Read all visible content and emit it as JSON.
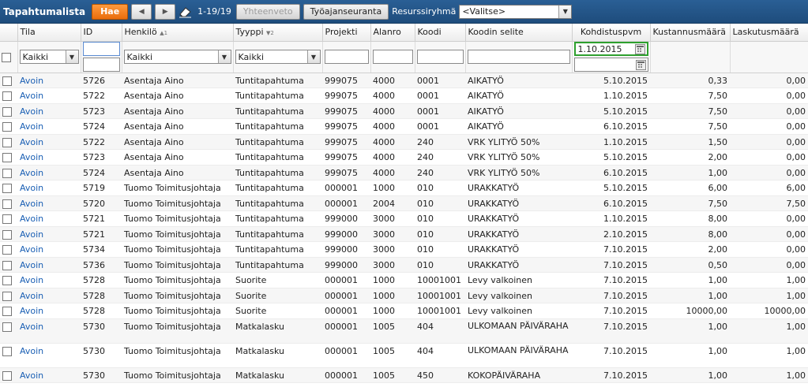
{
  "toolbar": {
    "title": "Tapahtumalista",
    "search_label": "Hae",
    "range": "1-19/19",
    "summary_label": "Yhteenveto",
    "tracking_label": "Työajanseuranta",
    "resource_group_label": "Resurssiryhmä",
    "resource_group_value": "<Valitse>"
  },
  "columns": [
    "Tila",
    "ID",
    "Henkilö",
    "Tyyppi",
    "Projekti",
    "Alanro",
    "Koodi",
    "Koodin selite",
    "Kohdistuspvm",
    "Kustannusmäärä",
    "Laskutusmäärä"
  ],
  "sort": {
    "henkilo": "▲1",
    "tyyppi": "▼2"
  },
  "filters": {
    "tila": "Kaikki",
    "henkilo": "Kaikki",
    "tyyppi": "Kaikki",
    "kohdistuspvm_from": "1.10.2015",
    "kohdistuspvm_to": ""
  },
  "rows": [
    {
      "tila": "Avoin",
      "id": "5726",
      "henkilo": "Asentaja Aino",
      "tyyppi": "Tuntitapahtuma",
      "projekti": "999075",
      "alanro": "4000",
      "koodi": "0001",
      "selite": "AIKATYÖ",
      "pvm": "5.10.2015",
      "kustannus": "0,33",
      "laskutus": "0,00"
    },
    {
      "tila": "Avoin",
      "id": "5722",
      "henkilo": "Asentaja Aino",
      "tyyppi": "Tuntitapahtuma",
      "projekti": "999075",
      "alanro": "4000",
      "koodi": "0001",
      "selite": "AIKATYÖ",
      "pvm": "1.10.2015",
      "kustannus": "7,50",
      "laskutus": "0,00"
    },
    {
      "tila": "Avoin",
      "id": "5723",
      "henkilo": "Asentaja Aino",
      "tyyppi": "Tuntitapahtuma",
      "projekti": "999075",
      "alanro": "4000",
      "koodi": "0001",
      "selite": "AIKATYÖ",
      "pvm": "5.10.2015",
      "kustannus": "7,50",
      "laskutus": "0,00"
    },
    {
      "tila": "Avoin",
      "id": "5724",
      "henkilo": "Asentaja Aino",
      "tyyppi": "Tuntitapahtuma",
      "projekti": "999075",
      "alanro": "4000",
      "koodi": "0001",
      "selite": "AIKATYÖ",
      "pvm": "6.10.2015",
      "kustannus": "7,50",
      "laskutus": "0,00"
    },
    {
      "tila": "Avoin",
      "id": "5722",
      "henkilo": "Asentaja Aino",
      "tyyppi": "Tuntitapahtuma",
      "projekti": "999075",
      "alanro": "4000",
      "koodi": "240",
      "selite": "VRK YLITYÖ 50%",
      "pvm": "1.10.2015",
      "kustannus": "1,50",
      "laskutus": "0,00"
    },
    {
      "tila": "Avoin",
      "id": "5723",
      "henkilo": "Asentaja Aino",
      "tyyppi": "Tuntitapahtuma",
      "projekti": "999075",
      "alanro": "4000",
      "koodi": "240",
      "selite": "VRK YLITYÖ 50%",
      "pvm": "5.10.2015",
      "kustannus": "2,00",
      "laskutus": "0,00"
    },
    {
      "tila": "Avoin",
      "id": "5724",
      "henkilo": "Asentaja Aino",
      "tyyppi": "Tuntitapahtuma",
      "projekti": "999075",
      "alanro": "4000",
      "koodi": "240",
      "selite": "VRK YLITYÖ 50%",
      "pvm": "6.10.2015",
      "kustannus": "1,00",
      "laskutus": "0,00"
    },
    {
      "tila": "Avoin",
      "id": "5719",
      "henkilo": "Tuomo Toimitusjohtaja",
      "tyyppi": "Tuntitapahtuma",
      "projekti": "000001",
      "alanro": "1000",
      "koodi": "010",
      "selite": "URAKKATYÖ",
      "pvm": "5.10.2015",
      "kustannus": "6,00",
      "laskutus": "6,00"
    },
    {
      "tila": "Avoin",
      "id": "5720",
      "henkilo": "Tuomo Toimitusjohtaja",
      "tyyppi": "Tuntitapahtuma",
      "projekti": "000001",
      "alanro": "2004",
      "koodi": "010",
      "selite": "URAKKATYÖ",
      "pvm": "6.10.2015",
      "kustannus": "7,50",
      "laskutus": "7,50"
    },
    {
      "tila": "Avoin",
      "id": "5721",
      "henkilo": "Tuomo Toimitusjohtaja",
      "tyyppi": "Tuntitapahtuma",
      "projekti": "999000",
      "alanro": "3000",
      "koodi": "010",
      "selite": "URAKKATYÖ",
      "pvm": "1.10.2015",
      "kustannus": "8,00",
      "laskutus": "0,00"
    },
    {
      "tila": "Avoin",
      "id": "5721",
      "henkilo": "Tuomo Toimitusjohtaja",
      "tyyppi": "Tuntitapahtuma",
      "projekti": "999000",
      "alanro": "3000",
      "koodi": "010",
      "selite": "URAKKATYÖ",
      "pvm": "2.10.2015",
      "kustannus": "8,00",
      "laskutus": "0,00"
    },
    {
      "tila": "Avoin",
      "id": "5734",
      "henkilo": "Tuomo Toimitusjohtaja",
      "tyyppi": "Tuntitapahtuma",
      "projekti": "999000",
      "alanro": "3000",
      "koodi": "010",
      "selite": "URAKKATYÖ",
      "pvm": "7.10.2015",
      "kustannus": "2,00",
      "laskutus": "0,00"
    },
    {
      "tila": "Avoin",
      "id": "5736",
      "henkilo": "Tuomo Toimitusjohtaja",
      "tyyppi": "Tuntitapahtuma",
      "projekti": "999000",
      "alanro": "3000",
      "koodi": "010",
      "selite": "URAKKATYÖ",
      "pvm": "7.10.2015",
      "kustannus": "0,50",
      "laskutus": "0,00"
    },
    {
      "tila": "Avoin",
      "id": "5728",
      "henkilo": "Tuomo Toimitusjohtaja",
      "tyyppi": "Suorite",
      "projekti": "000001",
      "alanro": "1000",
      "koodi": "10001001",
      "selite": "Levy valkoinen",
      "pvm": "7.10.2015",
      "kustannus": "1,00",
      "laskutus": "1,00"
    },
    {
      "tila": "Avoin",
      "id": "5728",
      "henkilo": "Tuomo Toimitusjohtaja",
      "tyyppi": "Suorite",
      "projekti": "000001",
      "alanro": "1000",
      "koodi": "10001001",
      "selite": "Levy valkoinen",
      "pvm": "7.10.2015",
      "kustannus": "1,00",
      "laskutus": "1,00"
    },
    {
      "tila": "Avoin",
      "id": "5728",
      "henkilo": "Tuomo Toimitusjohtaja",
      "tyyppi": "Suorite",
      "projekti": "000001",
      "alanro": "1000",
      "koodi": "10001001",
      "selite": "Levy valkoinen",
      "pvm": "7.10.2015",
      "kustannus": "10000,00",
      "laskutus": "10000,00"
    },
    {
      "tila": "Avoin",
      "id": "5730",
      "henkilo": "Tuomo Toimitusjohtaja",
      "tyyppi": "Matkalasku",
      "projekti": "000001",
      "alanro": "1005",
      "koodi": "404",
      "selite": "ULKOMAAN PÄIVÄRAHA MUUTT",
      "pvm": "7.10.2015",
      "kustannus": "1,00",
      "laskutus": "1,00"
    },
    {
      "tila": "Avoin",
      "id": "5730",
      "henkilo": "Tuomo Toimitusjohtaja",
      "tyyppi": "Matkalasku",
      "projekti": "000001",
      "alanro": "1005",
      "koodi": "404",
      "selite": "ULKOMAAN PÄIVÄRAHA MUUTT",
      "pvm": "7.10.2015",
      "kustannus": "1,00",
      "laskutus": "1,00"
    },
    {
      "tila": "Avoin",
      "id": "5730",
      "henkilo": "Tuomo Toimitusjohtaja",
      "tyyppi": "Matkalasku",
      "projekti": "000001",
      "alanro": "1005",
      "koodi": "450",
      "selite": "KOKOPÄIVÄRAHA",
      "pvm": "7.10.2015",
      "kustannus": "1,00",
      "laskutus": "1,00"
    }
  ],
  "colors": {
    "toolbar": "#2a5f95",
    "primary_button": "#f0821f",
    "link": "#1a5fb4",
    "active_border": "#2ea02e"
  }
}
